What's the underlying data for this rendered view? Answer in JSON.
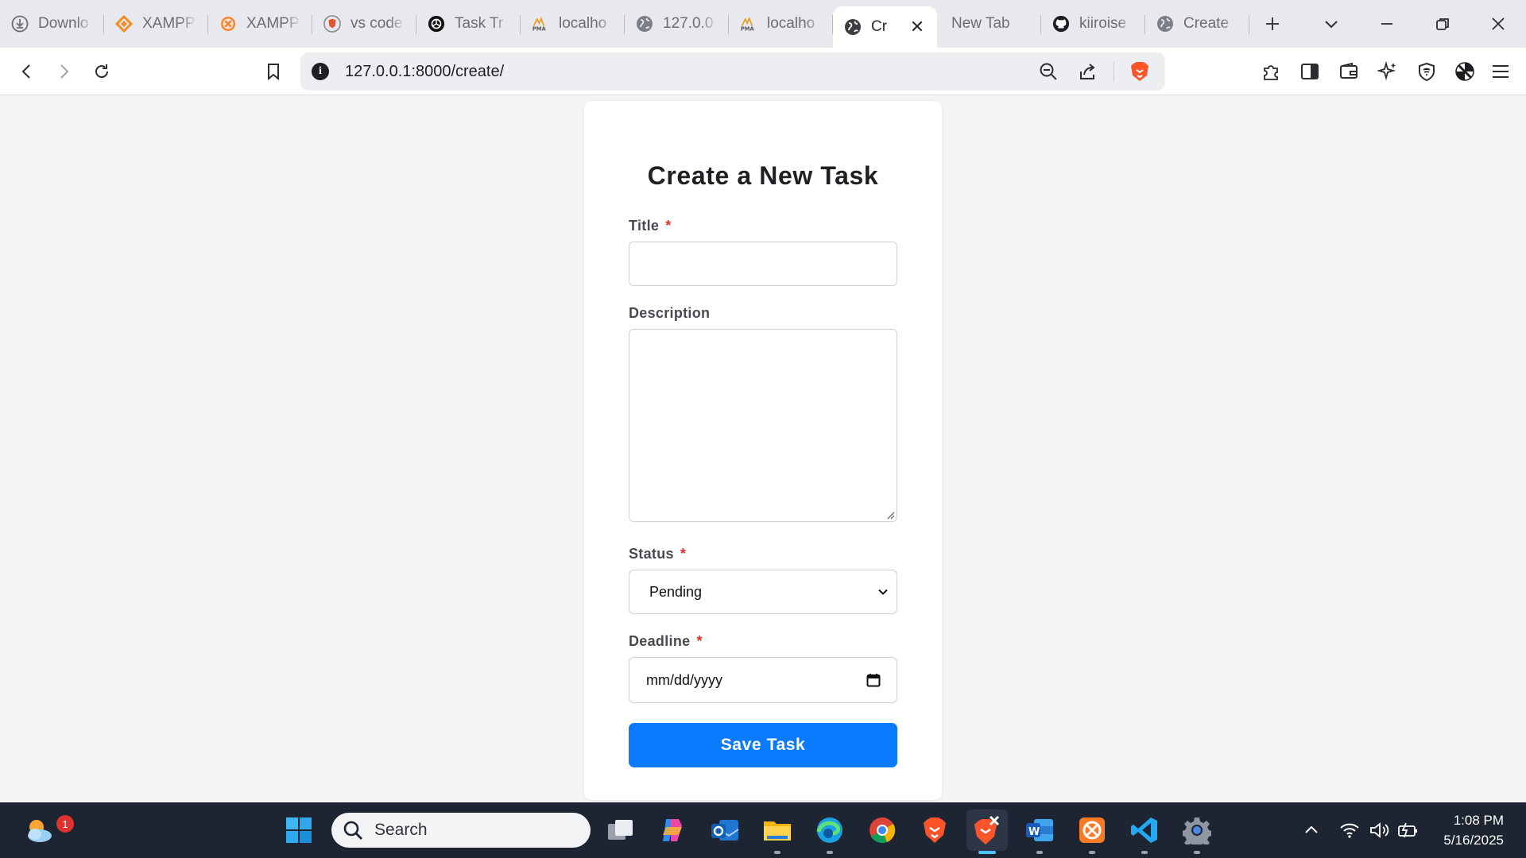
{
  "browser": {
    "tabs": [
      {
        "title": "Downlo",
        "icon": "download-icon"
      },
      {
        "title": "XAMPP",
        "icon": "xampp-diamond-icon"
      },
      {
        "title": "XAMPP",
        "icon": "xampp-logo-icon"
      },
      {
        "title": "vs code",
        "icon": "brave-shield-icon"
      },
      {
        "title": "Task Tr",
        "icon": "openai-icon"
      },
      {
        "title": "localho",
        "icon": "phpmyadmin-icon"
      },
      {
        "title": "127.0.0",
        "icon": "globe-icon"
      },
      {
        "title": "localho",
        "icon": "phpmyadmin-icon"
      },
      {
        "title": "Cr",
        "icon": "globe-icon",
        "active": true
      },
      {
        "title": "New Tab",
        "icon": ""
      },
      {
        "title": "kiiroise",
        "icon": "github-icon"
      },
      {
        "title": "Create",
        "icon": "globe-icon"
      }
    ],
    "url": "127.0.0.1:8000/create/"
  },
  "form": {
    "heading": "Create a New Task",
    "title_label": "Title",
    "title_value": "",
    "description_label": "Description",
    "description_value": "",
    "status_label": "Status",
    "status_selected": "Pending",
    "deadline_label": "Deadline",
    "deadline_placeholder": "mm/dd/yyyy",
    "required_mark": "*",
    "submit_label": "Save Task"
  },
  "taskbar": {
    "search_label": "Search",
    "weather_badge": "1",
    "time": "1:08 PM",
    "date": "5/16/2025"
  },
  "colors": {
    "accent": "#0a7bff",
    "required": "#e0302b",
    "taskbar": "#1d2533"
  }
}
